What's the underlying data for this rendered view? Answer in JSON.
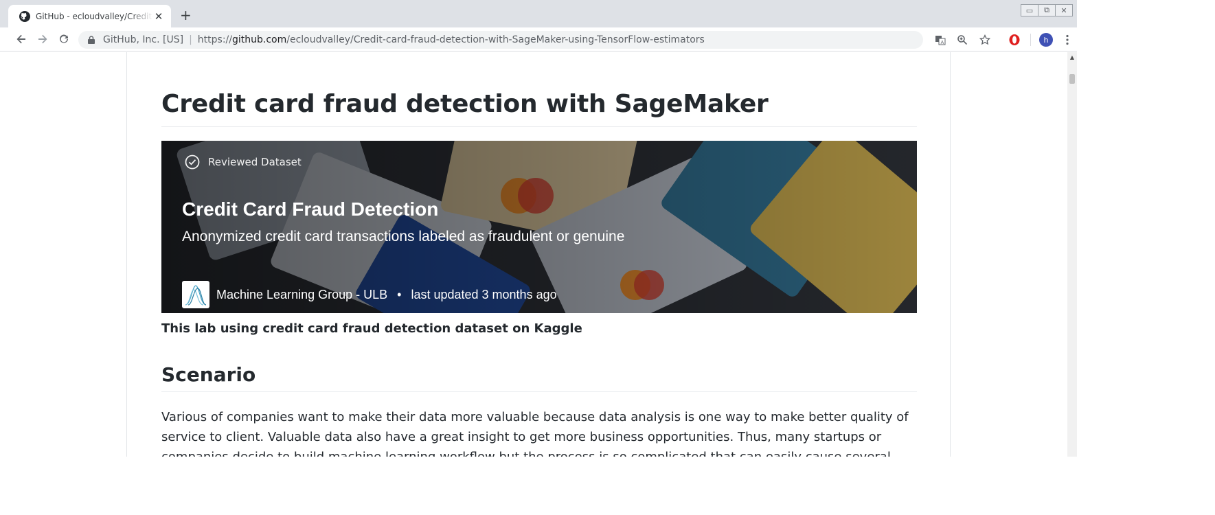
{
  "browser": {
    "tab_title": "GitHub - ecloudvalley/Credit-card-fraud-detection-with-SageMaker-using-TensorFlow-estimators",
    "new_tab_label": "+",
    "close_label": "✕",
    "origin_label": "GitHub, Inc. [US]",
    "url_scheme": "https://",
    "url_domain": "github.com",
    "url_path": "/ecloudvalley/Credit-card-fraud-detection-with-SageMaker-using-TensorFlow-estimators",
    "profile_initial": "h",
    "icons": {
      "back": "back-arrow-icon",
      "forward": "forward-arrow-icon",
      "reload": "reload-icon",
      "lock": "lock-icon",
      "translate": "translate-icon",
      "zoom": "zoom-icon",
      "bookmark": "star-icon",
      "opera": "opera-icon",
      "menu": "kebab-menu-icon"
    }
  },
  "readme": {
    "title": "Credit card fraud detection with SageMaker",
    "banner": {
      "badge": "Reviewed Dataset",
      "title": "Credit Card Fraud Detection",
      "subtitle": "Anonymized credit card transactions labeled as fraudulent or genuine",
      "author": "Machine Learning Group - ULB",
      "separator": "•",
      "updated": "last updated 3 months ago"
    },
    "caption": "This lab using credit card fraud detection dataset on Kaggle",
    "section_heading": "Scenario",
    "paragraph": "Various of companies want to make their data more valuable because data analysis is one way to make better quality of service to client. Valuable data also have a great insight to get more business opportunities. Thus, many startups or companies decide to build machine learning workflow but the process is so complicated that can easily cause several problems. One of main"
  },
  "colors": {
    "link_accent": "#0366d6",
    "chrome_tabstrip": "#dee1e6",
    "profile_avatar": "#3f51b5",
    "opera_red": "#e0201f"
  }
}
